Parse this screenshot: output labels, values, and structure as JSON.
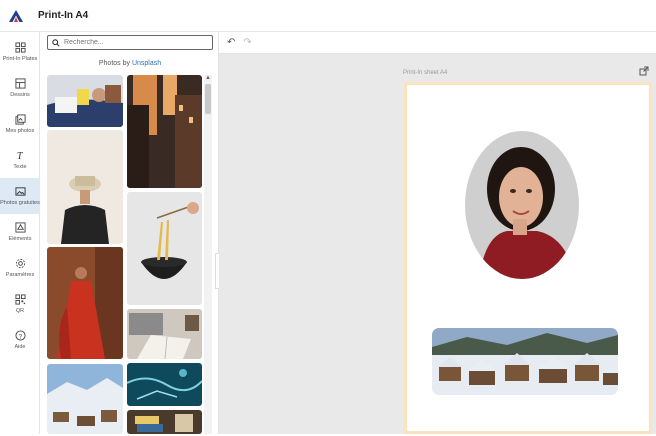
{
  "app": {
    "title": "Print-In A4",
    "brand_color": "#1f3c8f"
  },
  "nav": {
    "items": [
      {
        "label": "Print-In Plates",
        "icon": "template-grid-icon"
      },
      {
        "label": "Dessins",
        "icon": "drawing-icon"
      },
      {
        "label": "Mes photos",
        "icon": "my-photos-icon"
      },
      {
        "label": "Texte",
        "icon": "text-icon"
      },
      {
        "label": "Photos gratuites",
        "icon": "free-photos-icon"
      },
      {
        "label": "Éléments",
        "icon": "elements-icon"
      },
      {
        "label": "Paramètres",
        "icon": "settings-icon"
      },
      {
        "label": "QR",
        "icon": "qr-code-icon"
      },
      {
        "label": "Aide",
        "icon": "help-icon"
      }
    ],
    "active_index": 4,
    "active_color": "#dde9f5"
  },
  "panel": {
    "search_placeholder": "Recherche...",
    "photos_by_prefix": "Photos by",
    "photos_by_link": "Unsplash"
  },
  "canvas": {
    "sheet_label": "Print-In sheet A4",
    "sheet_border_color": "#fbe3c0"
  }
}
